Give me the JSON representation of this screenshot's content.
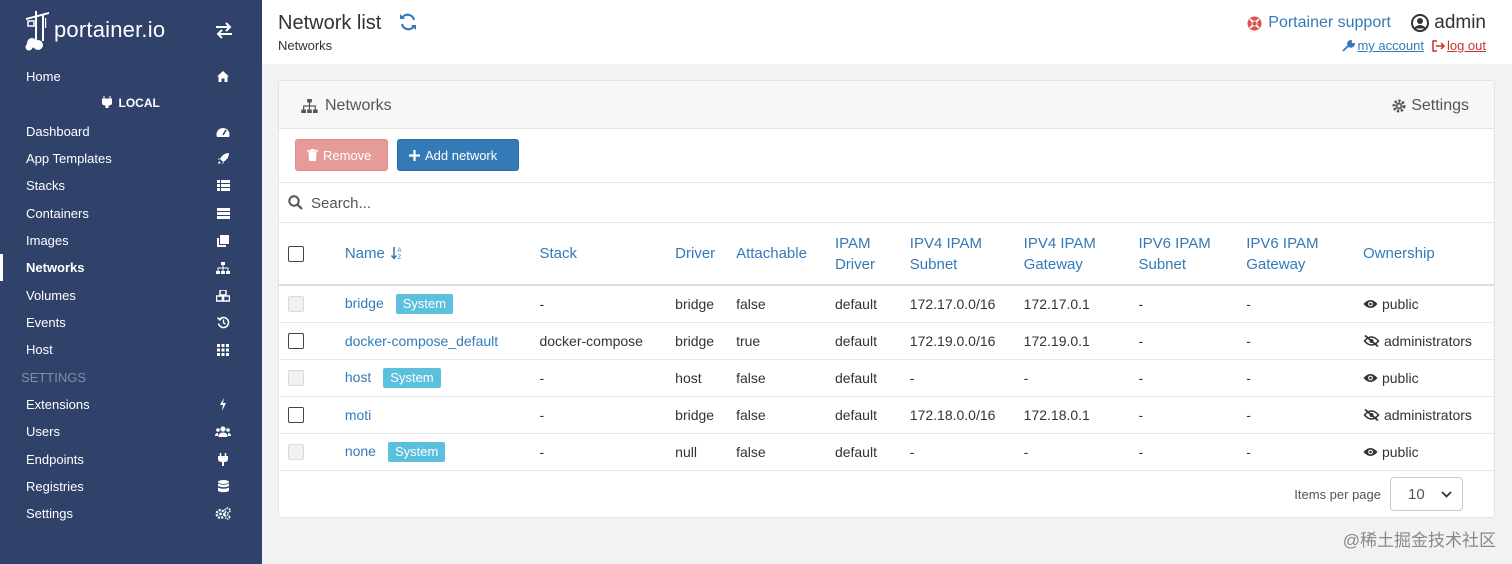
{
  "brand": {
    "logo_text": "portainer.io"
  },
  "sidebar": {
    "home": "Home",
    "endpoint": "LOCAL",
    "items": [
      {
        "label": "Dashboard",
        "icon": "tachometer-icon"
      },
      {
        "label": "App Templates",
        "icon": "rocket-icon"
      },
      {
        "label": "Stacks",
        "icon": "th-list-icon"
      },
      {
        "label": "Containers",
        "icon": "server-icon"
      },
      {
        "label": "Images",
        "icon": "clone-icon"
      },
      {
        "label": "Networks",
        "icon": "sitemap-icon"
      },
      {
        "label": "Volumes",
        "icon": "cubes-icon"
      },
      {
        "label": "Events",
        "icon": "history-icon"
      },
      {
        "label": "Host",
        "icon": "th-icon"
      }
    ],
    "settings_heading": "SETTINGS",
    "settings_items": [
      {
        "label": "Extensions",
        "icon": "bolt-icon"
      },
      {
        "label": "Users",
        "icon": "users-icon"
      },
      {
        "label": "Endpoints",
        "icon": "plug-icon"
      },
      {
        "label": "Registries",
        "icon": "database-icon"
      },
      {
        "label": "Settings",
        "icon": "cogs-icon"
      }
    ]
  },
  "header": {
    "title": "Network list",
    "breadcrumb": "Networks",
    "support": "Portainer support",
    "user": "admin",
    "my_account": "my account",
    "log_out": "log out"
  },
  "panel": {
    "title": "Networks",
    "settings": "Settings",
    "remove_label": "Remove",
    "add_label": "Add network",
    "search_placeholder": "Search..."
  },
  "table": {
    "headers": {
      "name": "Name",
      "stack": "Stack",
      "driver": "Driver",
      "attachable": "Attachable",
      "ipam_driver_1": "IPAM",
      "ipam_driver_2": "Driver",
      "ipv4_subnet_1": "IPV4 IPAM",
      "ipv4_subnet_2": "Subnet",
      "ipv4_gateway_1": "IPV4 IPAM",
      "ipv4_gateway_2": "Gateway",
      "ipv6_subnet_1": "IPV6 IPAM",
      "ipv6_subnet_2": "Subnet",
      "ipv6_gateway_1": "IPV6 IPAM",
      "ipv6_gateway_2": "Gateway",
      "ownership": "Ownership"
    },
    "rows": [
      {
        "name": "bridge",
        "badge": "System",
        "stack": "-",
        "driver": "bridge",
        "attachable": "false",
        "ipam_driver": "default",
        "ipv4_subnet": "172.17.0.0/16",
        "ipv4_gateway": "172.17.0.1",
        "ipv6_subnet": "-",
        "ipv6_gateway": "-",
        "ownership": "public"
      },
      {
        "name": "docker-compose_default",
        "badge": "",
        "stack": "docker-compose",
        "driver": "bridge",
        "attachable": "true",
        "ipam_driver": "default",
        "ipv4_subnet": "172.19.0.0/16",
        "ipv4_gateway": "172.19.0.1",
        "ipv6_subnet": "-",
        "ipv6_gateway": "-",
        "ownership": "administrators"
      },
      {
        "name": "host",
        "badge": "System",
        "stack": "-",
        "driver": "host",
        "attachable": "false",
        "ipam_driver": "default",
        "ipv4_subnet": "-",
        "ipv4_gateway": "-",
        "ipv6_subnet": "-",
        "ipv6_gateway": "-",
        "ownership": "public"
      },
      {
        "name": "moti",
        "badge": "",
        "stack": "-",
        "driver": "bridge",
        "attachable": "false",
        "ipam_driver": "default",
        "ipv4_subnet": "172.18.0.0/16",
        "ipv4_gateway": "172.18.0.1",
        "ipv6_subnet": "-",
        "ipv6_gateway": "-",
        "ownership": "administrators"
      },
      {
        "name": "none",
        "badge": "System",
        "stack": "-",
        "driver": "null",
        "attachable": "false",
        "ipam_driver": "default",
        "ipv4_subnet": "-",
        "ipv4_gateway": "-",
        "ipv6_subnet": "-",
        "ipv6_gateway": "-",
        "ownership": "public"
      }
    ]
  },
  "pager": {
    "label": "Items per page",
    "value": "10"
  },
  "watermark": "@稀土掘金技术社区",
  "colors": {
    "sidebar": "#30426a",
    "accent": "#337ab7",
    "danger": "#d9534f",
    "info": "#5bc0de"
  }
}
